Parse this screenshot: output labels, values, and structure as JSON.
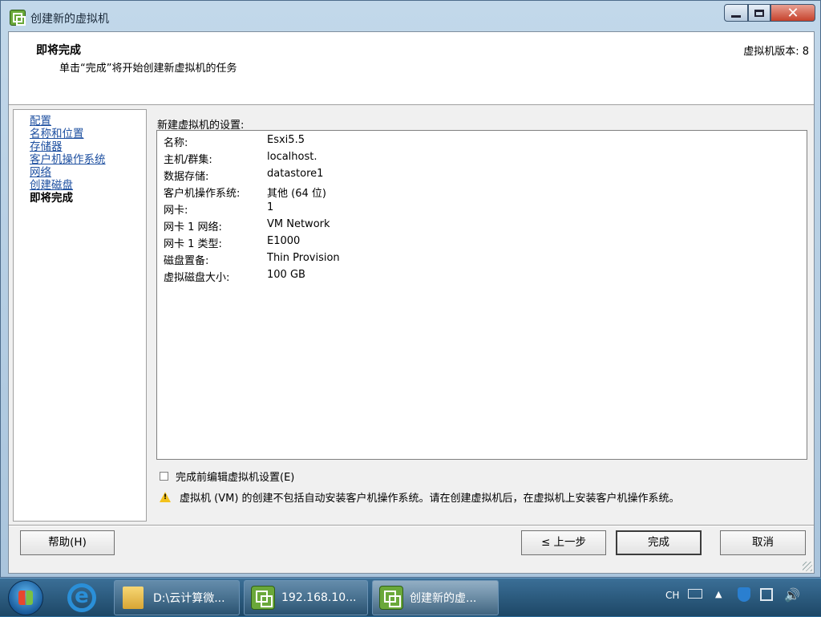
{
  "window": {
    "title": "创建新的虚拟机",
    "min_label": "",
    "max_label": "",
    "close_label": "✕"
  },
  "header": {
    "title": "即将完成",
    "subtitle": "单击“完成”将开始创建新虚拟机的任务",
    "version": "虚拟机版本: 8"
  },
  "nav": {
    "items": [
      {
        "label": "配置"
      },
      {
        "label": "名称和位置"
      },
      {
        "label": "存储器"
      },
      {
        "label": "客户机操作系统"
      },
      {
        "label": "网络"
      },
      {
        "label": "创建磁盘"
      },
      {
        "label": "即将完成",
        "current": true
      }
    ]
  },
  "settings": {
    "label": "新建虚拟机的设置:",
    "rows": [
      {
        "key": "名称:",
        "value": "Esxi5.5"
      },
      {
        "key": "主机/群集:",
        "value": "localhost."
      },
      {
        "key": "数据存储:",
        "value": "datastore1"
      },
      {
        "key": "客户机操作系统:",
        "value": "其他 (64 位)"
      },
      {
        "key": "网卡:",
        "value": "1"
      },
      {
        "key": "网卡 1 网络:",
        "value": "VM Network"
      },
      {
        "key": "网卡 1 类型:",
        "value": "E1000"
      },
      {
        "key": "磁盘置备:",
        "value": "Thin Provision"
      },
      {
        "key": "虚拟磁盘大小:",
        "value": "100 GB"
      }
    ]
  },
  "edit_before_finish": {
    "label": "完成前编辑虚拟机设置(E)",
    "checked": false
  },
  "warning": {
    "text": "虚拟机 (VM) 的创建不包括自动安装客户机操作系统。请在创建虚拟机后，在虚拟机上安装客户机操作系统。"
  },
  "buttons": {
    "help": "帮助(H)",
    "back": "≤ 上一步",
    "finish": "完成",
    "cancel": "取消"
  },
  "taskbar": {
    "tasks": [
      {
        "label": "D:\\云计算微..."
      },
      {
        "label": "192.168.10..."
      },
      {
        "label": "创建新的虚..."
      }
    ],
    "tray": {
      "lang": "CH"
    }
  }
}
